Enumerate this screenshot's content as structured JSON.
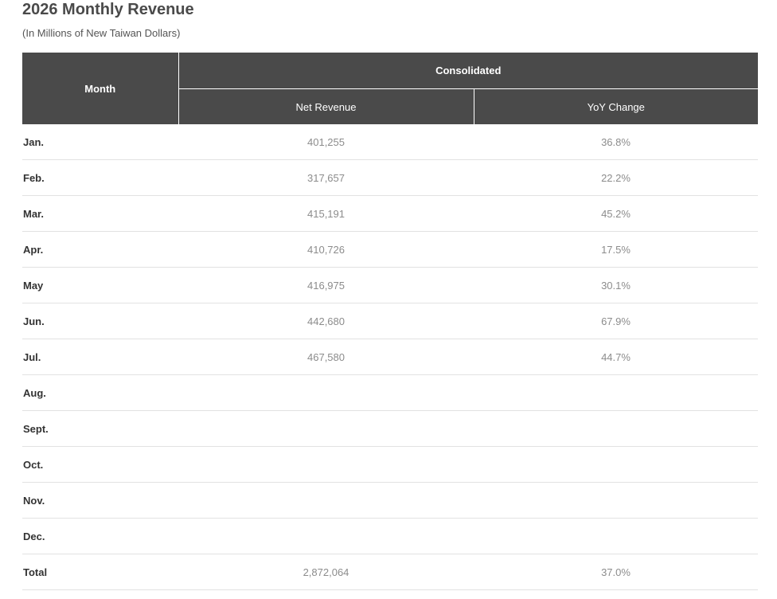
{
  "page": {
    "title": "2026 Monthly Revenue",
    "subtitle": "(In Millions of New Taiwan Dollars)"
  },
  "table": {
    "month_header": "Month",
    "group_header": "Consolidated",
    "net_revenue_header": "Net Revenue",
    "yoy_header": "YoY Change",
    "rows": [
      {
        "month": "Jan.",
        "net_revenue": "401,255",
        "yoy": "36.8%"
      },
      {
        "month": "Feb.",
        "net_revenue": "317,657",
        "yoy": "22.2%"
      },
      {
        "month": "Mar.",
        "net_revenue": "415,191",
        "yoy": "45.2%"
      },
      {
        "month": "Apr.",
        "net_revenue": "410,726",
        "yoy": "17.5%"
      },
      {
        "month": "May",
        "net_revenue": "416,975",
        "yoy": "30.1%"
      },
      {
        "month": "Jun.",
        "net_revenue": "442,680",
        "yoy": "67.9%"
      },
      {
        "month": "Jul.",
        "net_revenue": "467,580",
        "yoy": "44.7%"
      },
      {
        "month": "Aug.",
        "net_revenue": "",
        "yoy": ""
      },
      {
        "month": "Sept.",
        "net_revenue": "",
        "yoy": ""
      },
      {
        "month": "Oct.",
        "net_revenue": "",
        "yoy": ""
      },
      {
        "month": "Nov.",
        "net_revenue": "",
        "yoy": ""
      },
      {
        "month": "Dec.",
        "net_revenue": "",
        "yoy": ""
      }
    ],
    "total": {
      "label": "Total",
      "net_revenue": "2,872,064",
      "yoy": "37.0%"
    }
  }
}
